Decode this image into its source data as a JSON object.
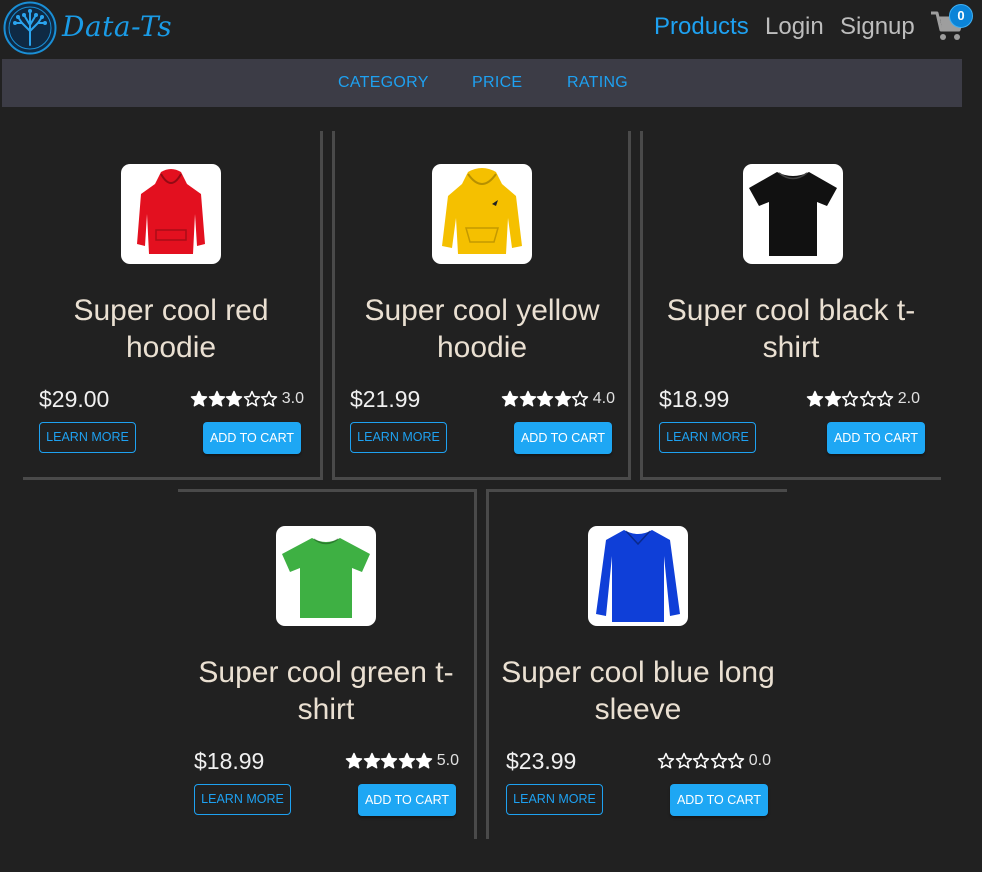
{
  "header": {
    "brand": "Data-Ts",
    "nav": {
      "products": "Products",
      "login": "Login",
      "signup": "Signup"
    },
    "cart_count": "0",
    "accent_color": "#1ea1f1"
  },
  "filters": {
    "category": "CATEGORY",
    "price": "PRICE",
    "rating": "RATING"
  },
  "products": [
    {
      "title": "Super cool red hoodie",
      "price": "$29.00",
      "rating": 3,
      "rating_label": "3.0",
      "image": "red-hoodie",
      "color": "#e3101f",
      "learn_more": "LEARN MORE",
      "add_to_cart": "ADD TO CART"
    },
    {
      "title": "Super cool yellow hoodie",
      "price": "$21.99",
      "rating": 4,
      "rating_label": "4.0",
      "image": "yellow-hoodie",
      "color": "#f5c000",
      "learn_more": "LEARN MORE",
      "add_to_cart": "ADD TO CART"
    },
    {
      "title": "Super cool black t-shirt",
      "price": "$18.99",
      "rating": 2,
      "rating_label": "2.0",
      "image": "black-tshirt",
      "color": "#111111",
      "learn_more": "LEARN MORE",
      "add_to_cart": "ADD TO CART"
    },
    {
      "title": "Super cool green t-shirt",
      "price": "$18.99",
      "rating": 5,
      "rating_label": "5.0",
      "image": "green-tshirt",
      "color": "#3eb043",
      "learn_more": "LEARN MORE",
      "add_to_cart": "ADD TO CART"
    },
    {
      "title": "Super cool blue long sleeve",
      "price": "$23.99",
      "rating": 0,
      "rating_label": "0.0",
      "image": "blue-long-sleeve",
      "color": "#0f3fd8",
      "learn_more": "LEARN MORE",
      "add_to_cart": "ADD TO CART"
    }
  ]
}
